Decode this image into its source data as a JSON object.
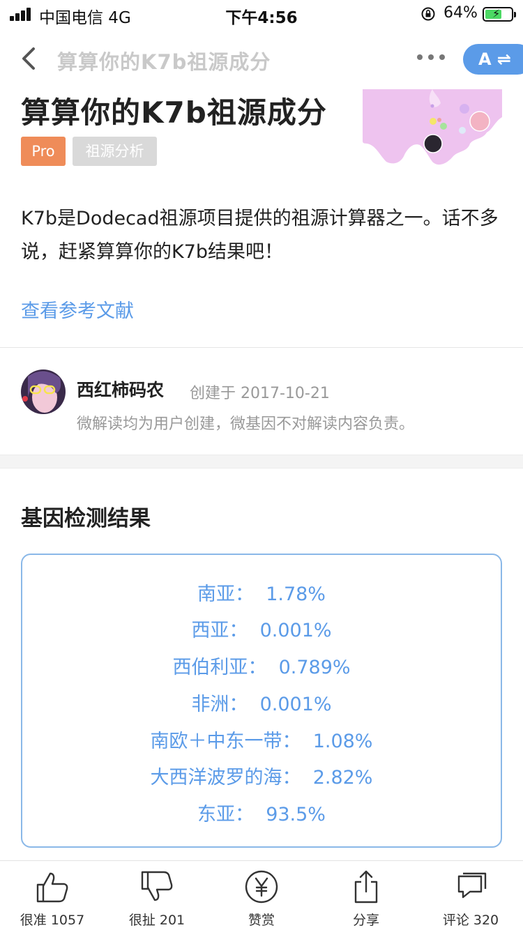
{
  "status_bar": {
    "carrier": "中国电信  4G",
    "time": "下午4:56",
    "battery_percent": "64%",
    "battery_level": 0.64
  },
  "nav": {
    "title": "算算你的K7b祖源成分",
    "translate_label": "A ⇌"
  },
  "header": {
    "title": "算算你的K7b祖源成分",
    "tags": [
      "Pro",
      "祖源分析"
    ],
    "description": "K7b是Dodecad祖源项目提供的祖源计算器之一。话不多说，赶紧算算你的K7b结果吧！",
    "reference_link": "查看参考文献"
  },
  "author": {
    "name": "西红柿码农",
    "created": "创建于 2017-10-21",
    "note": "微解读均为用户创建，微基因不对解读内容负责。"
  },
  "results": {
    "title": "基因检测结果",
    "rows": [
      {
        "label": "南亚：",
        "value": "1.78%"
      },
      {
        "label": "西亚：",
        "value": "0.001%"
      },
      {
        "label": "西伯利亚：",
        "value": "0.789%"
      },
      {
        "label": "非洲：",
        "value": "0.001%"
      },
      {
        "label": "南欧＋中东一带：",
        "value": "1.08%"
      },
      {
        "label": "大西洋波罗的海：",
        "value": "2.82%"
      },
      {
        "label": "东亚：",
        "value": "93.5%"
      }
    ]
  },
  "tabbar": {
    "items": [
      {
        "label": "很准 1057",
        "icon": "thumbs-up-icon"
      },
      {
        "label": "很扯 201",
        "icon": "thumbs-down-icon"
      },
      {
        "label": "赞赏",
        "icon": "yuan-coin-icon"
      },
      {
        "label": "分享",
        "icon": "share-icon"
      },
      {
        "label": "评论 320",
        "icon": "comment-icon"
      }
    ]
  },
  "colors": {
    "accent": "#5b9be8",
    "pro_tag": "#ef8c59",
    "category_tag": "#d9d9d9",
    "map": "#eec3ef"
  }
}
